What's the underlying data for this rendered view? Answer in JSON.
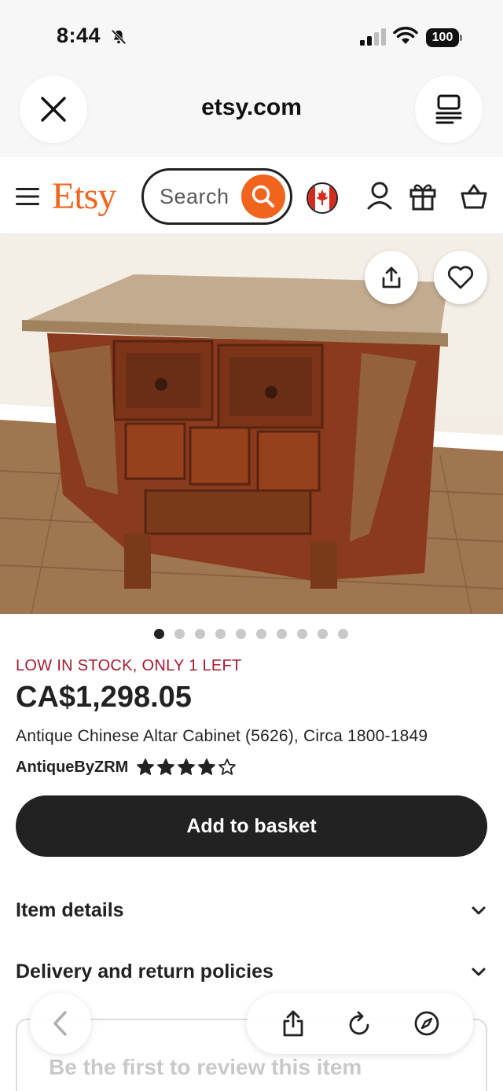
{
  "status_bar": {
    "time": "8:44",
    "battery": "100"
  },
  "browser": {
    "url": "etsy.com"
  },
  "header": {
    "logo": "Etsy",
    "search_placeholder": "Search"
  },
  "product": {
    "image_count": 10,
    "active_image_index": 0,
    "stock_notice": "LOW IN STOCK, ONLY 1 LEFT",
    "price": "CA$1,298.05",
    "title": "Antique Chinese Altar Cabinet (5626), Circa 1800-1849",
    "shop_name": "AntiqueByZRM",
    "rating_stars": 4,
    "rating_max": 5,
    "add_to_basket_label": "Add to basket"
  },
  "sections": {
    "item_details": "Item details",
    "delivery_returns": "Delivery and return policies"
  },
  "reviews": {
    "empty_text": "Be the first to review this item"
  },
  "colors": {
    "brand_orange": "#f1641e",
    "stock_red": "#a61a2e",
    "button_dark": "#222222"
  }
}
